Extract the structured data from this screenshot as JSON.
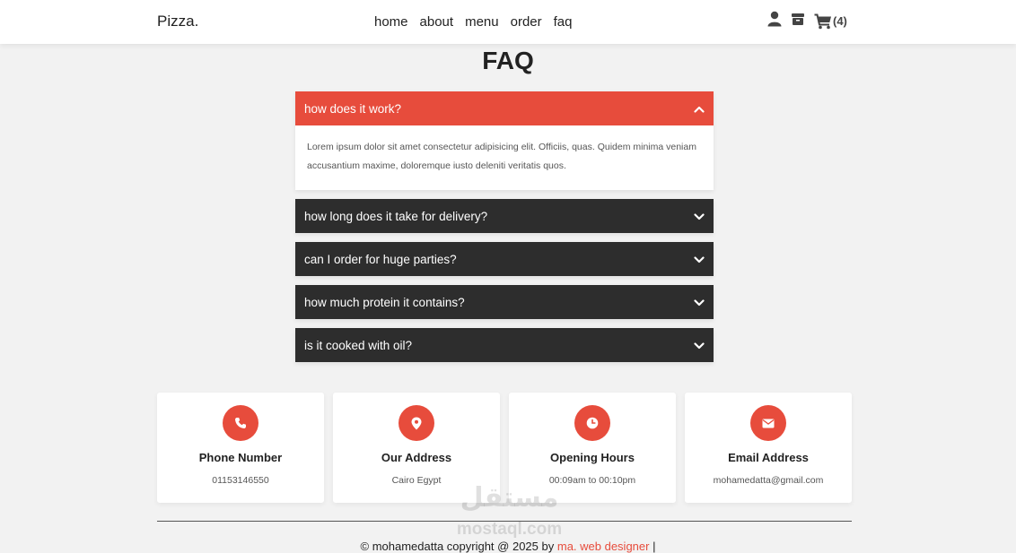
{
  "header": {
    "logo": "Pizza.",
    "nav": [
      "home",
      "about",
      "menu",
      "order",
      "faq"
    ],
    "icons": [
      "user-icon",
      "box-icon",
      "cart-icon"
    ],
    "cart_count": "(4)"
  },
  "faq": {
    "title": "FAQ",
    "items": [
      {
        "question": "how does it work?",
        "answer": "Lorem ipsum dolor sit amet consectetur adipisicing elit. Officiis, quas. Quidem minima veniam accusantium maxime, doloremque iusto deleniti veritatis quos.",
        "expanded": true
      },
      {
        "question": "how long does it take for delivery?",
        "expanded": false
      },
      {
        "question": "can I order for huge parties?",
        "expanded": false
      },
      {
        "question": "how much protein it contains?",
        "expanded": false
      },
      {
        "question": "is it cooked with oil?",
        "expanded": false
      }
    ]
  },
  "info": [
    {
      "icon": "phone-icon",
      "title": "Phone Number",
      "value": "01153146550"
    },
    {
      "icon": "location-icon",
      "title": "Our Address",
      "value": "Cairo Egypt"
    },
    {
      "icon": "clock-icon",
      "title": "Opening Hours",
      "value": "00:09am to 00:10pm"
    },
    {
      "icon": "envelope-icon",
      "title": "Email Address",
      "value": "mohamedatta@gmail.com"
    }
  ],
  "footer": {
    "credit_prefix": "© mohamedatta copyright @ 2025 by",
    "credit_link": "ma. web designer",
    "credit_suffix": "|"
  },
  "watermark": {
    "arabic": "مستقل",
    "latin": "mostaql.com"
  },
  "colors": {
    "accent": "#e74c3c",
    "dark": "#2d2d2d",
    "background": "#f2f2f2"
  }
}
